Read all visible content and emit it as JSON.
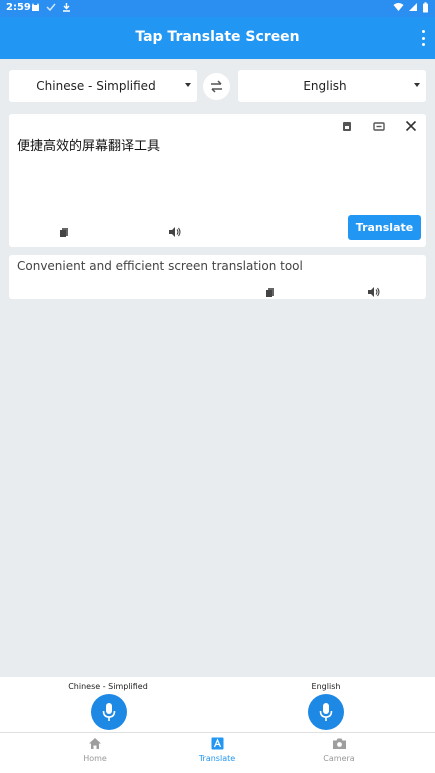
{
  "status_bar": {
    "time": "2:59"
  },
  "app_bar": {
    "title": "Tap Translate Screen"
  },
  "languages": {
    "source": "Chinese - Simplified",
    "target": "English"
  },
  "input": {
    "text": "便捷高效的屏幕翻译工具"
  },
  "actions": {
    "translate_label": "Translate"
  },
  "output": {
    "text": "Convenient and efficient screen translation tool"
  },
  "voice": {
    "source_label": "Chinese - Simplified",
    "target_label": "English"
  },
  "nav": {
    "home": "Home",
    "translate": "Translate",
    "camera": "Camera"
  },
  "colors": {
    "primary": "#2196f3",
    "status_bar": "#2a8ff0",
    "background": "#e9ecef"
  }
}
